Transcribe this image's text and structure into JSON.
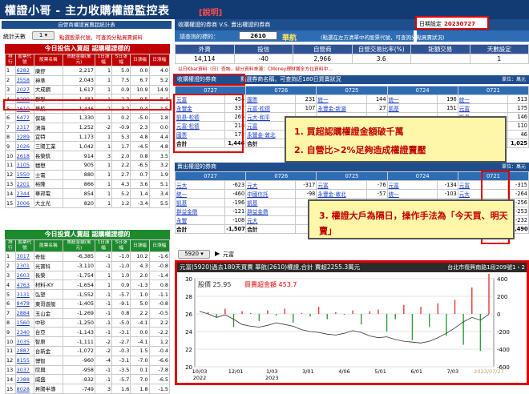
{
  "app": {
    "title": "權證小哥 - 主力收購權證監控表",
    "tagline": "[說明]",
    "date_label": "日期設定",
    "date_value": "20230727"
  },
  "left": {
    "subhead": "自營商權證買賣超統計表",
    "stat_label": "統計天數",
    "stat_value": "1",
    "stat_hint": "點選股票代號，可查詢分點買賣資料",
    "buy_title": "今日投信入買超 認購權證標的",
    "sell_title": "今日投資人賣超 認購權證標的",
    "cols": [
      "排行",
      "股票代號",
      "股票名稱",
      "買超金額(萬元)",
      "1日漲幅",
      "5日漲幅",
      "日漲幅"
    ],
    "buy_rows": [
      [
        "1",
        "6282",
        "康舒",
        "2,217",
        "1",
        "5.0",
        "0.0",
        "4.0"
      ],
      [
        "2",
        "3558",
        "神準",
        "2,043",
        "1",
        "7.5",
        "6.7",
        "5.2"
      ],
      [
        "3",
        "2027",
        "大成鋼",
        "1,617",
        "1",
        "0.9",
        "10.9",
        "14.9"
      ],
      [
        "4",
        "8299",
        "群聯",
        "1,483",
        "1",
        "2.3",
        "0.5",
        "5.4"
      ],
      [
        "5",
        "2610",
        "華航",
        "1,446",
        "2",
        "3.2",
        "0.4",
        "1.5"
      ],
      [
        "6",
        "6472",
        "保瑞",
        "1,330",
        "1",
        "0.2",
        "-5.0",
        "1.8"
      ],
      [
        "7",
        "2317",
        "鴻海",
        "1,252",
        "-2",
        "-0.9",
        "2.3",
        "0.0"
      ],
      [
        "8",
        "3289",
        "宜特",
        "1,173",
        "1",
        "5.3",
        "4.8",
        "4.4"
      ],
      [
        "9",
        "2026",
        "三陽工業",
        "1,042",
        "1",
        "1.7",
        "-4.5",
        "4.8"
      ],
      [
        "10",
        "2618",
        "長榮航",
        "914",
        "3",
        "2.0",
        "0.8",
        "3.5"
      ],
      [
        "11",
        "3105",
        "穩懋",
        "905",
        "1",
        "2.2",
        "-6.5",
        "3.2"
      ],
      [
        "12",
        "1550",
        "士電",
        "880",
        "1",
        "2.7",
        "0.7",
        "1.9"
      ],
      [
        "13",
        "2201",
        "裕隆",
        "866",
        "1",
        "4.3",
        "3.6",
        "5.1"
      ],
      [
        "14",
        "2344",
        "華邦電",
        "854",
        "1",
        "5.2",
        "1.4",
        "3.4"
      ],
      [
        "15",
        "3006",
        "大立光",
        "820",
        "1",
        "1.2",
        "-3.4",
        "5.5"
      ]
    ],
    "sell_rows": [
      [
        "1",
        "3017",
        "奇鋐",
        "-6,385",
        "-1",
        "-1.0",
        "10.2",
        "-1.6"
      ],
      [
        "2",
        "2301",
        "光寶科",
        "-3,110",
        "-1",
        "-1.0",
        "4.3",
        "-0.8"
      ],
      [
        "3",
        "2603",
        "長榮",
        "-1,754",
        "1",
        "1.0",
        "2.0",
        "-1.4"
      ],
      [
        "4",
        "4763",
        "材料-KY",
        "-1,654",
        "1",
        "0.9",
        "-1.3",
        "0.8"
      ],
      [
        "5",
        "3131",
        "弘塑",
        "-1,552",
        "-1",
        "-5.7",
        "1.0",
        "-1.1"
      ],
      [
        "6",
        "8478",
        "東哥遊艇",
        "-1,405",
        "-1",
        "-9.1",
        "5.0",
        "-0.8"
      ],
      [
        "7",
        "2884",
        "玉山金",
        "-1,269",
        "-1",
        "0.8",
        "2.2",
        "-0.5"
      ],
      [
        "8",
        "1560",
        "中砂",
        "-1,250",
        "-1",
        "-5.0",
        "-4.1",
        "2.2"
      ],
      [
        "9",
        "2340",
        "台亞",
        "-1,143",
        "-1",
        "-3.1",
        "0.0",
        "-2.2"
      ],
      [
        "10",
        "3035",
        "智原",
        "-1,111",
        "-2",
        "-2.7",
        "-4.1",
        "1.2"
      ],
      [
        "11",
        "2887",
        "台新金",
        "-1,072",
        "-2",
        "-0.3",
        "1.5",
        "-0.4"
      ],
      [
        "12",
        "8155",
        "博智",
        "-960",
        "-4",
        "-3.1",
        "-7.0",
        "-6.6"
      ],
      [
        "13",
        "3037",
        "欣興",
        "-958",
        "-1",
        "-3.5",
        "0.1",
        "-7.8"
      ],
      [
        "14",
        "2388",
        "威盛",
        "-932",
        "-1",
        "-5.7",
        "7.0",
        "-6.5"
      ],
      [
        "15",
        "8028",
        "昇陽半導",
        "-749",
        "3",
        "1.6",
        "1.8",
        "-1.5"
      ]
    ]
  },
  "mid": {
    "head_left": "收購權證的券商",
    "head_right": "收購權證的券商 V.S. 賣出權證的券商",
    "query_label": "請查詢的標的：",
    "code": "2610",
    "name": "華航",
    "query_hint": "(點選在左方清單中的股票代號，可查詢分點買賣狀況)",
    "stats_cols": [
      "外資",
      "投信",
      "自營商",
      "自營交易比率(%)",
      "鉅額交易",
      "天數設定"
    ],
    "stats_vals": [
      "14,114",
      "-40",
      "2,966",
      "3.6",
      "",
      "1"
    ],
    "notice": "以日Kbar資料（日）查詢，部分資料來源：CMoney理財寶全方位資料中...",
    "buy_head": "收購權證的券商",
    "buy_note": "點選券商名稱，可查詢近180日買賣狀況",
    "unit": "單位：萬元",
    "dates": [
      "0727",
      "0726",
      "0725",
      "0724",
      "0721"
    ],
    "buy_rows": [
      [
        [
          "元富",
          "454"
        ],
        [
          "國票",
          "231"
        ],
        [
          "統一",
          "144"
        ],
        [
          "統一",
          "196"
        ],
        [
          "統一",
          "513"
        ]
      ],
      [
        [
          "永豐金",
          "337"
        ],
        [
          "元富-松德",
          "107"
        ],
        [
          "永豐金-新湖",
          "27"
        ],
        [
          "凱基",
          "151"
        ],
        [
          "元富",
          "175"
        ]
      ],
      [
        [
          "凱基-松德",
          "265"
        ],
        [
          "元大-和平",
          "",
          ""
        ],
        [
          "",
          ""
        ],
        [
          "",
          ""
        ],
        [
          "凱基",
          "146"
        ]
      ],
      [
        [
          "元富-松德",
          "218"
        ],
        [
          "元富",
          "",
          ""
        ],
        [
          "",
          ""
        ],
        [
          "",
          ""
        ],
        [
          "",
          "110"
        ]
      ],
      [
        [
          "國票",
          "172"
        ],
        [
          "永豐金-敦北",
          "",
          ""
        ],
        [
          "",
          ""
        ],
        [
          "",
          ""
        ],
        [
          "",
          "46"
        ]
      ]
    ],
    "buy_sum": [
      "合計",
      "1,446",
      "合計",
      "",
      "",
      "",
      "",
      "",
      "",
      "1,025"
    ],
    "sell_head": "賣出權證的券商",
    "sell_unit": "單位：萬元",
    "sell_rows": [
      [
        [
          "元大",
          "-623"
        ],
        [
          "元大",
          "-317"
        ],
        [
          "元富",
          "-76"
        ],
        [
          "元富",
          "-134"
        ],
        [
          "元富",
          "-315"
        ]
      ],
      [
        [
          "統一",
          "-460"
        ],
        [
          "中國信託",
          "-98"
        ],
        [
          "永豐金-敦北",
          "-57"
        ],
        [
          "統一",
          "-103"
        ],
        [
          "元大",
          "-264"
        ]
      ],
      [
        [
          "凱基",
          "-196"
        ],
        [
          "凱基",
          "-7"
        ],
        [
          "",
          ""
        ],
        [
          "",
          ""
        ],
        [
          "",
          "-256"
        ]
      ],
      [
        [
          "群益金鼎",
          "-121"
        ],
        [
          "群益金鼎",
          "",
          ""
        ],
        [
          "",
          ""
        ],
        [
          "",
          ""
        ],
        [
          "",
          "-253"
        ]
      ],
      [
        [
          "永豐",
          "-108"
        ],
        [
          "元大",
          "",
          ""
        ],
        [
          "",
          ""
        ],
        [
          "",
          ""
        ],
        [
          "",
          "-232"
        ]
      ]
    ],
    "sell_sum": [
      "合計",
      "-1,507",
      "合計",
      "",
      "",
      "",
      "",
      "",
      "",
      "-1,490"
    ]
  },
  "chart": {
    "search_code": "5920",
    "search_name": "元富",
    "title": "元富(5920)過去180天買賣 華航(2610)權證,合計 賣超2255.3萬元",
    "right_note": "台北市復興南路1段209號1・2",
    "legend_price": "股價 25.95",
    "legend_buy": "買賣超金額 453.7",
    "x_labels": [
      "10/03\n2022",
      "12/01",
      "1/03\n2023",
      "3/01",
      "4/06",
      "5/01",
      "6/01",
      "7/03",
      "2023/07/27"
    ],
    "y_left": [
      "30",
      "28",
      "26",
      "24",
      "22",
      "20"
    ],
    "y_right": [
      "400",
      "200",
      "0",
      "-200",
      "-400",
      "-600"
    ]
  },
  "callouts": {
    "c1": "1.  買超認購權證金額破千萬",
    "c2": "2.  自營比>2%足夠造成權證賣壓",
    "c3": "3.  權證大戶為隔日，操作手法為「今天買、明天賣」"
  },
  "chart_data": {
    "type": "line",
    "title": "元富(5920)過去180天買賣 華航(2610)權證,合計 賣超2255.3萬元",
    "series": [
      {
        "name": "股價",
        "values": [
          26.3,
          26.0,
          25.6,
          25.9,
          25.4,
          24.8,
          24.6,
          24.5,
          24.7,
          25.0,
          24.8,
          24.6,
          24.2,
          24.0,
          23.9,
          23.7,
          23.6,
          23.8,
          24.1,
          23.9,
          23.5,
          23.3,
          23.4,
          23.1,
          22.9,
          22.8,
          22.7,
          22.9,
          23.3,
          23.8,
          24.4,
          25.1,
          25.6,
          25.3,
          25.95
        ]
      },
      {
        "name": "買賣超金額",
        "values": [
          0,
          20,
          -40,
          60,
          -150,
          30,
          10,
          -80,
          40,
          -20,
          60,
          -100,
          10,
          -30,
          80,
          -60,
          20,
          -10,
          40,
          -120,
          30,
          50,
          -200,
          -60,
          100,
          -300,
          80,
          -150,
          120,
          -250,
          160,
          -350,
          300,
          -420,
          453.7
        ]
      }
    ],
    "ylim": [
      20,
      30
    ],
    "y2lim": [
      -600,
      400
    ],
    "x_range": [
      "2022/10/03",
      "2023/07/27"
    ]
  }
}
